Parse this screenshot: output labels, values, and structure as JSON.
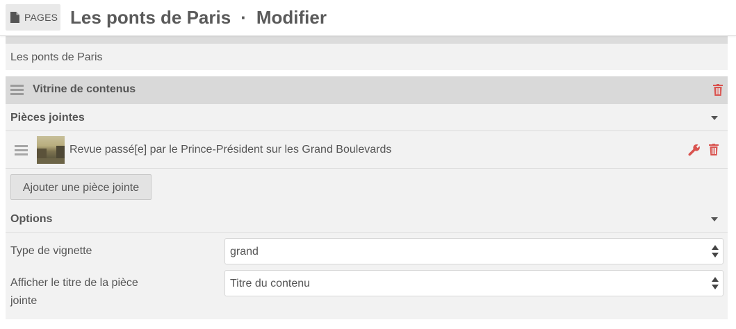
{
  "header": {
    "pages_label": "PAGES",
    "title_main": "Les ponts de Paris",
    "separator": "·",
    "title_action": "Modifier"
  },
  "page_title_field": {
    "value": "Les ponts de Paris"
  },
  "block": {
    "title": "Vitrine de contenus",
    "attachments_section": {
      "label": "Pièces jointes",
      "items": [
        {
          "title": "Revue passé[e] par le Prince-Président sur les Grand Boulevards"
        }
      ],
      "add_button_label": "Ajouter une pièce jointe"
    },
    "options_section": {
      "label": "Options",
      "thumbnail_type": {
        "label": "Type de vignette",
        "value": "grand"
      },
      "show_title": {
        "label": "Afficher le titre de la pièce jointe",
        "value": "Titre du contenu"
      }
    }
  },
  "colors": {
    "delete_icon": "#d9534f",
    "header_bg": "#ffffff",
    "block_header_bg": "#d9d9d9",
    "panel_bg": "#f2f2f2"
  },
  "icons": [
    "document-icon",
    "drag-handle-icon",
    "trash-icon",
    "wrench-icon",
    "caret-down-icon",
    "select-arrows-icon"
  ]
}
